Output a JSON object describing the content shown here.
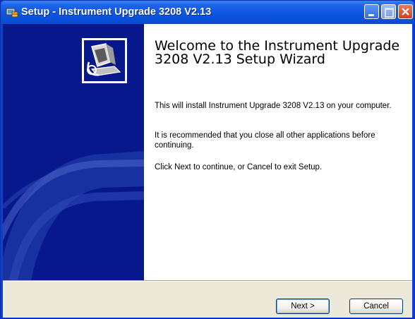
{
  "window": {
    "title": "Setup - Instrument Upgrade 3208 V2.13",
    "controls": {
      "minimize_icon": "minimize-icon",
      "maximize_icon": "maximize-icon",
      "close_icon": "close-icon"
    }
  },
  "wizard": {
    "heading": "Welcome to the Instrument Upgrade 3208 V2.13 Setup Wizard",
    "paragraph1": "This will install Instrument Upgrade 3208 V2.13 on your computer.",
    "paragraph2": "It is recommended that you close all other applications before continuing.",
    "paragraph3": "Click Next to continue, or Cancel to exit Setup."
  },
  "buttons": {
    "next": "Next >",
    "cancel": "Cancel"
  },
  "colors": {
    "side_panel": "#07188d",
    "title_bar": "#0a55e0",
    "dialog_face": "#ece9d8",
    "close_button": "#d1401d"
  }
}
